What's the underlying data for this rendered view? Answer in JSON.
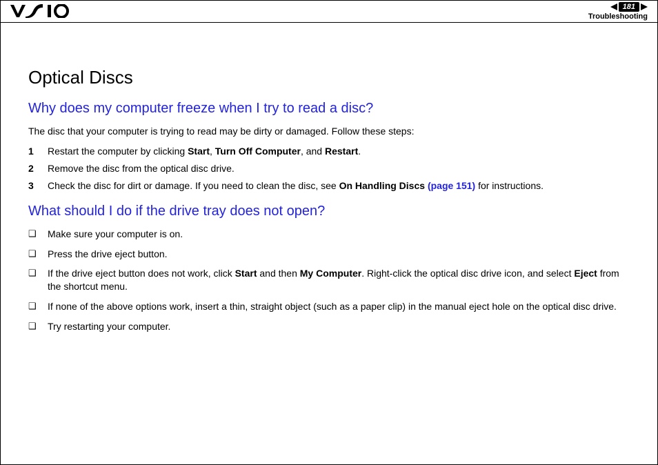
{
  "header": {
    "logo_text": "VAIO",
    "page_number": "181",
    "section": "Troubleshooting"
  },
  "main": {
    "title": "Optical Discs",
    "q1": {
      "heading": "Why does my computer freeze when I try to read a disc?",
      "intro": "The disc that your computer is trying to read may be dirty or damaged. Follow these steps:",
      "steps": [
        {
          "n": "1",
          "pre": "Restart the computer by clicking ",
          "b1": "Start",
          "mid1": ", ",
          "b2": "Turn Off Computer",
          "mid2": ", and ",
          "b3": "Restart",
          "post": "."
        },
        {
          "n": "2",
          "text": "Remove the disc from the optical disc drive."
        },
        {
          "n": "3",
          "pre": "Check the disc for dirt or damage. If you need to clean the disc, see ",
          "b1": "On Handling Discs ",
          "link": "(page 151)",
          "post": " for instructions."
        }
      ]
    },
    "q2": {
      "heading": "What should I do if the drive tray does not open?",
      "bullets": [
        {
          "text": "Make sure your computer is on."
        },
        {
          "text": "Press the drive eject button."
        },
        {
          "pre": "If the drive eject button does not work, click ",
          "b1": "Start",
          "mid1": " and then ",
          "b2": "My Computer",
          "mid2": ". Right-click the optical disc drive icon, and select ",
          "b3": "Eject",
          "post": " from the shortcut menu."
        },
        {
          "text": "If none of the above options work, insert a thin, straight object (such as a paper clip) in the manual eject hole on the optical disc drive."
        },
        {
          "text": "Try restarting your computer."
        }
      ]
    }
  }
}
